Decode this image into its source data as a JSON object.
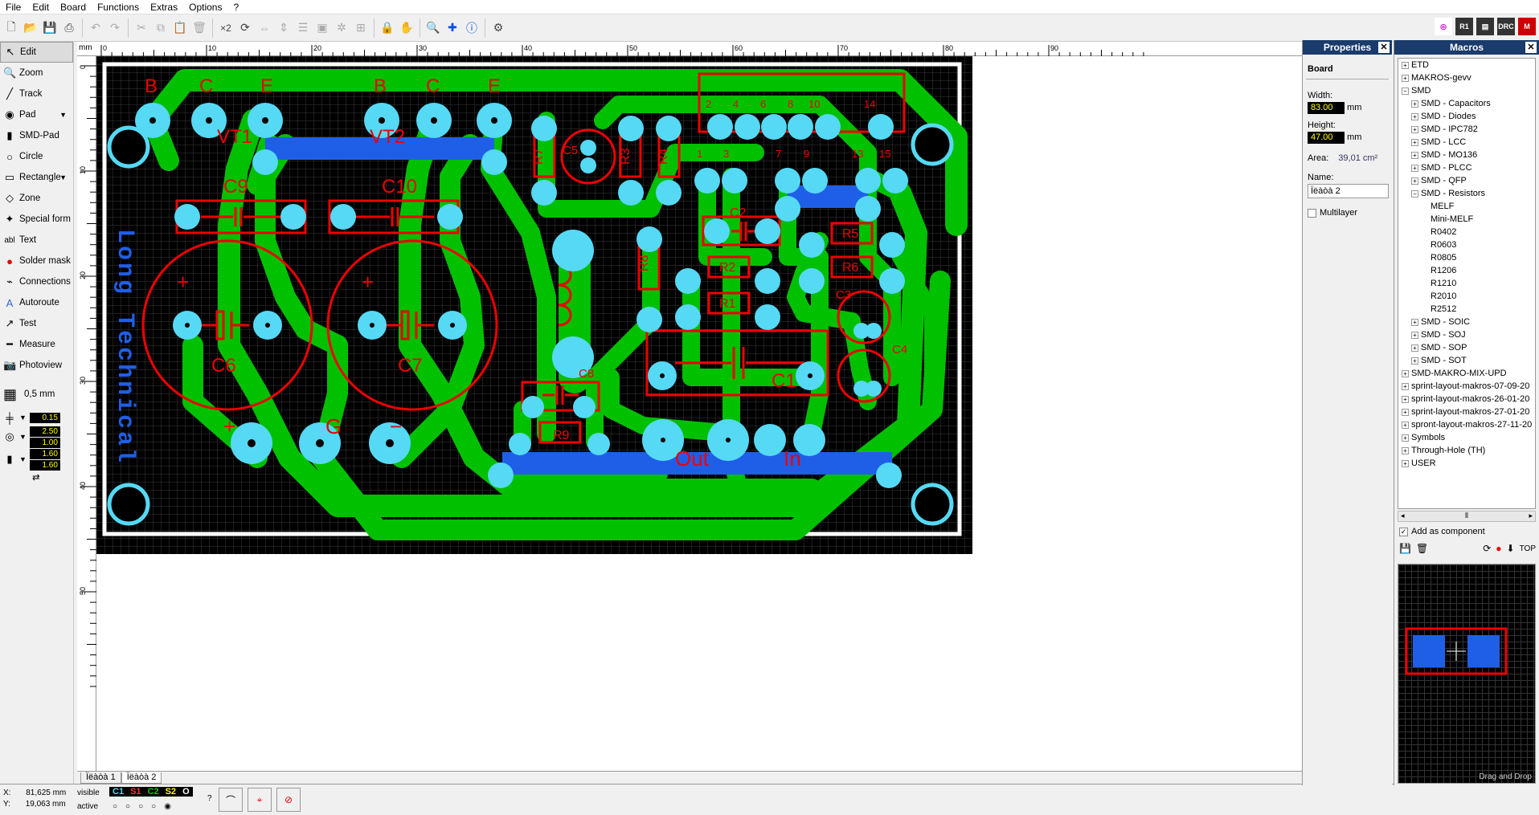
{
  "menu": [
    "File",
    "Edit",
    "Board",
    "Functions",
    "Extras",
    "Options",
    "?"
  ],
  "toolbar_text": {
    "x2": "×2"
  },
  "right_tools": [
    "R1",
    "DRC",
    "M"
  ],
  "left_tools": [
    {
      "label": "Edit",
      "icon": "arrow-icon"
    },
    {
      "label": "Zoom",
      "icon": "zoom-icon"
    },
    {
      "label": "Track",
      "icon": "track-icon"
    },
    {
      "label": "Pad",
      "icon": "pad-icon"
    },
    {
      "label": "SMD-Pad",
      "icon": "smd-pad-icon"
    },
    {
      "label": "Circle",
      "icon": "circle-icon"
    },
    {
      "label": "Rectangle",
      "icon": "rectangle-icon"
    },
    {
      "label": "Zone",
      "icon": "zone-icon"
    },
    {
      "label": "Special form",
      "icon": "special-form-icon"
    },
    {
      "label": "Text",
      "icon": "text-icon"
    },
    {
      "label": "Solder mask",
      "icon": "solder-mask-icon"
    },
    {
      "label": "Connections",
      "icon": "connections-icon"
    },
    {
      "label": "Autoroute",
      "icon": "autoroute-icon"
    },
    {
      "label": "Test",
      "icon": "test-icon"
    },
    {
      "label": "Measure",
      "icon": "measure-icon"
    },
    {
      "label": "Photoview",
      "icon": "photoview-icon"
    }
  ],
  "grid": "0,5 mm",
  "track_width": "0.15",
  "pad_outer": "2.50",
  "pad_inner": "1.00",
  "smd_w": "1.60",
  "smd_h": "1.60",
  "ruler": {
    "unit": "mm",
    "top": [
      "0",
      "10",
      "20",
      "30",
      "40",
      "50",
      "60",
      "70",
      "80",
      "90"
    ],
    "left": [
      "0",
      "10",
      "20",
      "30",
      "40",
      "50"
    ]
  },
  "pcb": {
    "labels": [
      "B",
      "C",
      "E",
      "B",
      "C",
      "E",
      "VT1",
      "VT2",
      "C9",
      "C10",
      "C6",
      "C7",
      "R7",
      "C5",
      "R3",
      "R4",
      "R8",
      "C2",
      "R2",
      "R1",
      "R5",
      "R6",
      "C3",
      "C4",
      "C1",
      "C8",
      "R9",
      "Out",
      "In",
      "G",
      "+",
      "−",
      "+",
      "+"
    ],
    "pin_numbers": [
      "2",
      "4",
      "6",
      "8",
      "10",
      "14",
      "1",
      "3",
      "7",
      "9",
      "13",
      "15"
    ],
    "vertical_text": "Long Technical"
  },
  "tabs": [
    "Ïëàòà 1",
    "Ïëàòà 2"
  ],
  "status": {
    "x_label": "X:",
    "x_value": "81,625 mm",
    "y_label": "Y:",
    "y_value": "19,063 mm",
    "visible": "visible",
    "active": "active",
    "layers": [
      "C1",
      "S1",
      "C2",
      "S2",
      "O"
    ],
    "q": "?"
  },
  "properties": {
    "title": "Properties",
    "section": "Board",
    "width_label": "Width:",
    "width": "83.00",
    "height_label": "Height:",
    "height": "47.00",
    "unit": "mm",
    "area_label": "Area:",
    "area": "39,01 cm²",
    "name_label": "Name:",
    "name": "Ïëàòà 2",
    "multilayer": "Multilayer"
  },
  "macros": {
    "title": "Macros",
    "add_component": "Add as component",
    "top": "TOP",
    "drag": "Drag and Drop",
    "tree": [
      {
        "t": "ETD",
        "d": 0,
        "s": "+"
      },
      {
        "t": "MAKROS-gevv",
        "d": 0,
        "s": "+"
      },
      {
        "t": "SMD",
        "d": 0,
        "s": "−"
      },
      {
        "t": "SMD - Capacitors",
        "d": 1,
        "s": "+"
      },
      {
        "t": "SMD - Diodes",
        "d": 1,
        "s": "+"
      },
      {
        "t": "SMD - IPC782",
        "d": 1,
        "s": "+"
      },
      {
        "t": "SMD - LCC",
        "d": 1,
        "s": "+"
      },
      {
        "t": "SMD - MO136",
        "d": 1,
        "s": "+"
      },
      {
        "t": "SMD - PLCC",
        "d": 1,
        "s": "+"
      },
      {
        "t": "SMD - QFP",
        "d": 1,
        "s": "+"
      },
      {
        "t": "SMD - Resistors",
        "d": 1,
        "s": "−"
      },
      {
        "t": "MELF",
        "d": 2,
        "s": ""
      },
      {
        "t": "Mini-MELF",
        "d": 2,
        "s": ""
      },
      {
        "t": "R0402",
        "d": 2,
        "s": ""
      },
      {
        "t": "R0603",
        "d": 2,
        "s": ""
      },
      {
        "t": "R0805",
        "d": 2,
        "s": ""
      },
      {
        "t": "R1206",
        "d": 2,
        "s": ""
      },
      {
        "t": "R1210",
        "d": 2,
        "s": ""
      },
      {
        "t": "R2010",
        "d": 2,
        "s": ""
      },
      {
        "t": "R2512",
        "d": 2,
        "s": ""
      },
      {
        "t": "SMD - SOIC",
        "d": 1,
        "s": "+"
      },
      {
        "t": "SMD - SOJ",
        "d": 1,
        "s": "+"
      },
      {
        "t": "SMD - SOP",
        "d": 1,
        "s": "+"
      },
      {
        "t": "SMD - SOT",
        "d": 1,
        "s": "+"
      },
      {
        "t": "SMD-MAKRO-MIX-UPD",
        "d": 0,
        "s": "+"
      },
      {
        "t": "sprint-layout-makros-07-09-20",
        "d": 0,
        "s": "+"
      },
      {
        "t": "sprint-layout-makros-26-01-20",
        "d": 0,
        "s": "+"
      },
      {
        "t": "sprint-layout-makros-27-01-20",
        "d": 0,
        "s": "+"
      },
      {
        "t": "spront-layout-makros-27-11-20",
        "d": 0,
        "s": "+"
      },
      {
        "t": "Symbols",
        "d": 0,
        "s": "+"
      },
      {
        "t": "Through-Hole (TH)",
        "d": 0,
        "s": "+"
      },
      {
        "t": "USER",
        "d": 0,
        "s": "+"
      }
    ]
  }
}
